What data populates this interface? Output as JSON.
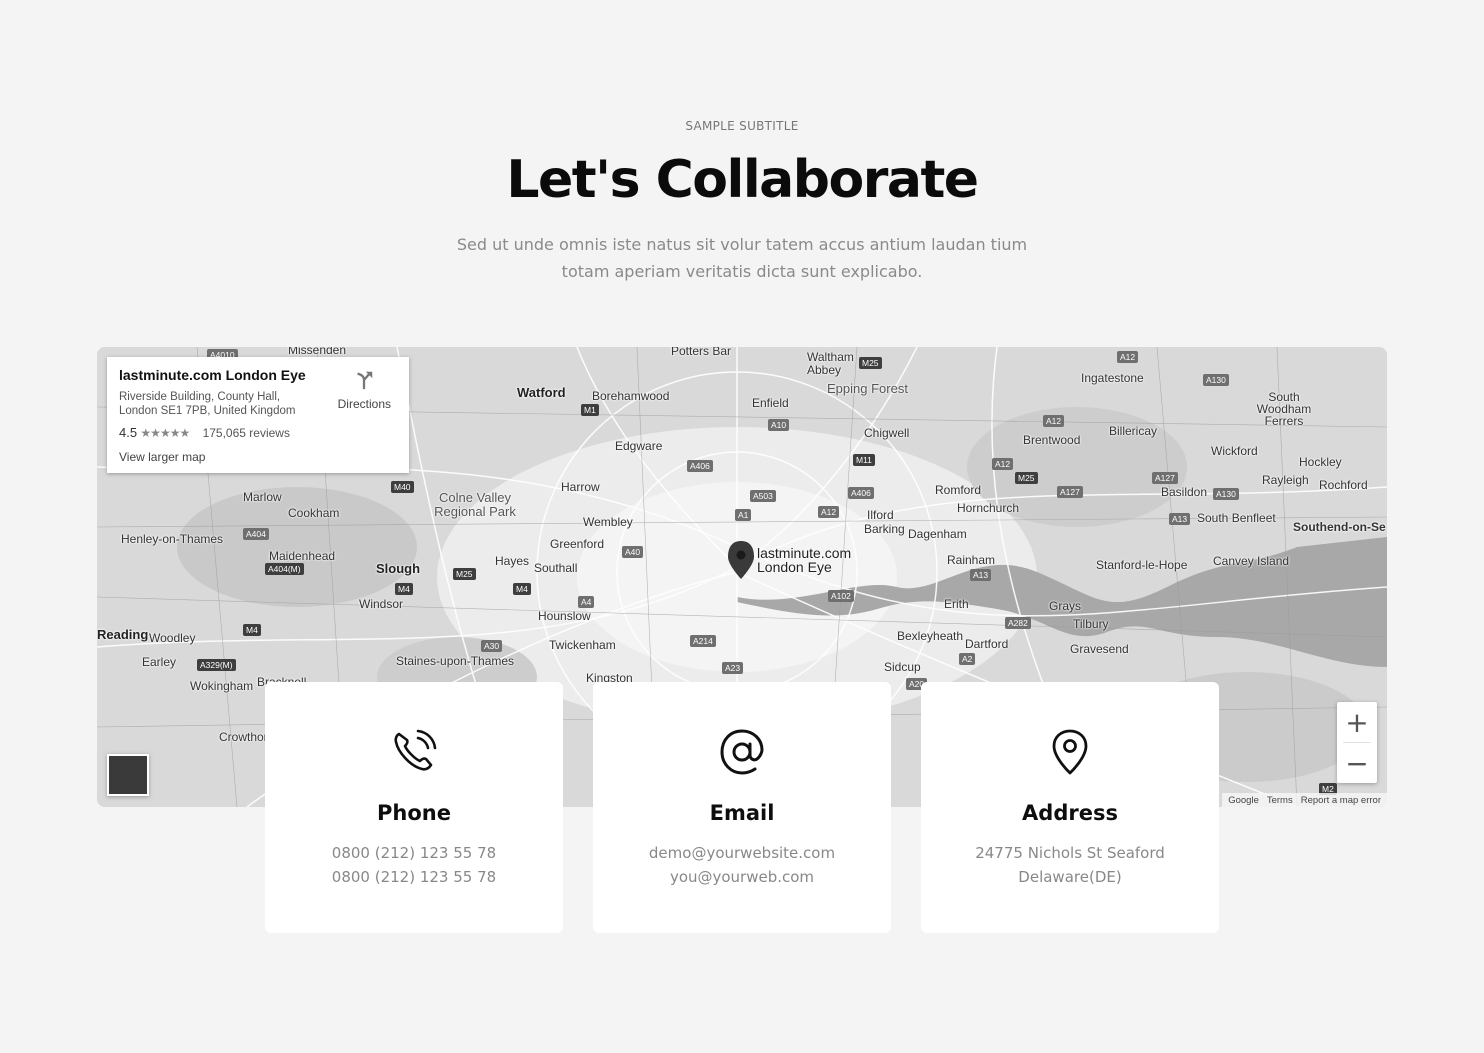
{
  "header": {
    "subtitle": "SAMPLE SUBTITLE",
    "title": "Let's Collaborate",
    "description_line1": "Sed ut unde omnis iste natus sit volur tatem accus antium laudan tium",
    "description_line2": "totam aperiam veritatis dicta sunt explicabo."
  },
  "map": {
    "info": {
      "name": "lastminute.com London Eye",
      "address_line1": "Riverside Building, County Hall,",
      "address_line2": "London SE1 7PB, United Kingdom",
      "rating": "4.5",
      "stars": "★★★★★",
      "reviews": "175,065 reviews",
      "larger_map": "View larger map",
      "directions": "Directions"
    },
    "pin_label_line1": "lastminute.com",
    "pin_label_line2": "London Eye",
    "zoom_in": "+",
    "zoom_out": "−",
    "attribution": [
      "Google",
      "Terms",
      "Report a map error"
    ],
    "places": [
      "Missenden",
      "Potters Bar",
      "Waltham Abbey",
      "Epping Forest",
      "Ingatestone",
      "Watford",
      "Borehamwood",
      "Enfield",
      "Chigwell",
      "Brentwood",
      "Billericay",
      "South Woodham Ferrers",
      "Edgware",
      "Wickford",
      "Hockley",
      "Rayleigh",
      "Rochford",
      "Marlow",
      "Cookham",
      "Colne Valley Regional Park",
      "Harrow",
      "Romford",
      "Hornchurch",
      "Basildon",
      "South Benfleet",
      "Southend-on-Se",
      "Wembley",
      "Ilford",
      "Barking",
      "Dagenham",
      "Henley-on-Thames",
      "Maidenhead",
      "Greenford",
      "Slough",
      "Hayes",
      "Southall",
      "Rainham",
      "Stanford-le-Hope",
      "Canvey Island",
      "Windsor",
      "Hounslow",
      "Erith",
      "Grays",
      "Reading",
      "Woodley",
      "Twickenham",
      "Bexleyheath",
      "Dartford",
      "Tilbury",
      "Gravesend",
      "Earley",
      "Wokingham",
      "Staines-upon-Thames",
      "Kingston",
      "Sidcup",
      "Bracknell",
      "Crowthorne"
    ],
    "roads": [
      "A4010",
      "M25",
      "A12",
      "A130",
      "M1",
      "A10",
      "A12",
      "A406",
      "M11",
      "A12",
      "M25",
      "A127",
      "A127",
      "A130",
      "M40",
      "A503",
      "A406",
      "A1",
      "A12",
      "A13",
      "A404",
      "A404(M)",
      "A40",
      "M25",
      "M4",
      "M4",
      "A4",
      "A102",
      "A13",
      "M4",
      "A30",
      "A214",
      "A282",
      "A329(M)",
      "A23",
      "A2",
      "A20",
      "M2"
    ]
  },
  "cards": [
    {
      "title": "Phone",
      "line1": "0800 (212) 123 55 78",
      "line2": "0800 (212) 123 55 78",
      "icon": "phone-icon"
    },
    {
      "title": "Email",
      "line1": "demo@yourwebsite.com",
      "line2": "you@yourweb.com",
      "icon": "at-sign-icon"
    },
    {
      "title": "Address",
      "line1": "24775 Nichols St Seaford",
      "line2": "Delaware(DE)",
      "icon": "map-pin-icon"
    }
  ],
  "colors": {
    "background": "#f4f4f4",
    "card": "#ffffff",
    "title": "#0b0b0b",
    "muted": "#888888",
    "map_base": "#d6d6d6"
  }
}
